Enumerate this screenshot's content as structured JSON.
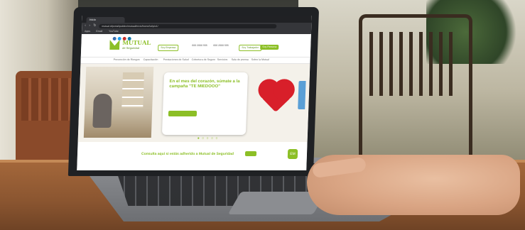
{
  "browser": {
    "tab_title": "Inicio",
    "url": "mutual.cl/portal/publico/mutual/inicio/home/!ut/p/z1/",
    "bookmarks": [
      "Apps",
      "Gmail",
      "YouTube"
    ]
  },
  "site": {
    "logo_text": "MUTUAL",
    "logo_sub": "de Seguridad",
    "header_chips": [
      "Soy Empresa",
      "Soy Trabajador"
    ],
    "header_button": "Soy Persona",
    "phone_label": "600 2000 555",
    "phone_label_2": "600 2000 555",
    "promo_line": "",
    "menu_items": [
      "Prevención de Riesgos",
      "Capacitación",
      "Prestaciones de Salud",
      "Cobertura de Seguro",
      "Servicios",
      "Sala de prensa",
      "Sobre la Mutual"
    ],
    "hero": {
      "title": "En el mes del corazón, súmate a la campaña \"TE MIEDOOO\"",
      "body": "",
      "button": ""
    },
    "banner_text": "Consulta aquí si estás adherido a Mutual de Seguridad",
    "banner_button": "",
    "float_icon_label": "EM"
  },
  "colors": {
    "brand_green": "#8cbf26",
    "heart_red": "#d81f2a",
    "table_wood": "#8a5530"
  }
}
